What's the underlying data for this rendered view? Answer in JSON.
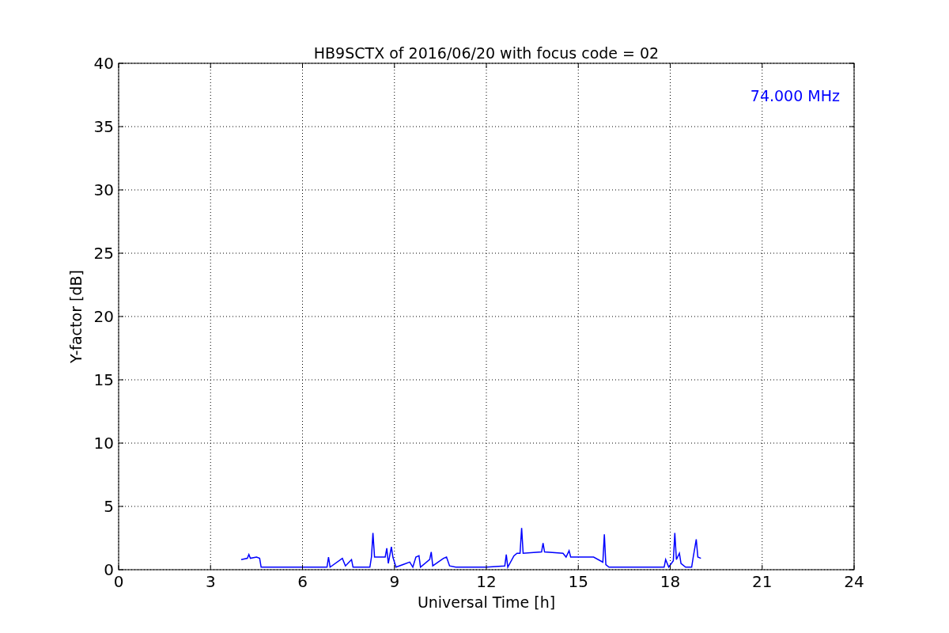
{
  "chart_data": {
    "type": "line",
    "title": "HB9SCTX of 2016/06/20 with focus code = 02",
    "xlabel": "Universal Time [h]",
    "ylabel": "Y-factor [dB]",
    "xlim": [
      0,
      24
    ],
    "ylim": [
      0,
      40
    ],
    "xticks": [
      0,
      3,
      6,
      9,
      12,
      15,
      18,
      21,
      24
    ],
    "yticks": [
      0,
      5,
      10,
      15,
      20,
      25,
      30,
      35,
      40
    ],
    "x": [
      4.0,
      4.2,
      4.25,
      4.3,
      4.5,
      4.6,
      4.65,
      5.0,
      6.0,
      6.8,
      6.85,
      6.9,
      7.3,
      7.4,
      7.6,
      7.65,
      8.2,
      8.25,
      8.3,
      8.35,
      8.7,
      8.75,
      8.8,
      8.9,
      8.95,
      9.05,
      9.5,
      9.6,
      9.7,
      9.8,
      9.85,
      10.15,
      10.2,
      10.25,
      10.6,
      10.7,
      10.8,
      11.0,
      12.0,
      12.6,
      12.65,
      12.7,
      12.9,
      13.0,
      13.1,
      13.15,
      13.2,
      13.8,
      13.85,
      13.9,
      14.5,
      14.6,
      14.7,
      14.75,
      15.5,
      15.8,
      15.85,
      15.9,
      16.0,
      17.0,
      17.8,
      17.85,
      17.95,
      18.1,
      18.15,
      18.2,
      18.3,
      18.35,
      18.5,
      18.7,
      18.75,
      18.85,
      18.9,
      19.0
    ],
    "series": [
      {
        "name": "74.000 MHz",
        "color": "#0000ff",
        "values": [
          0.8,
          0.9,
          1.2,
          0.9,
          1.0,
          0.9,
          0.2,
          0.2,
          0.2,
          0.2,
          1.0,
          0.2,
          0.9,
          0.3,
          0.8,
          0.2,
          0.2,
          1.0,
          2.9,
          1.0,
          1.0,
          1.7,
          0.5,
          1.8,
          1.0,
          0.2,
          0.6,
          0.2,
          1.0,
          1.1,
          0.2,
          0.8,
          1.4,
          0.3,
          0.9,
          1.0,
          0.3,
          0.2,
          0.2,
          0.3,
          1.2,
          0.2,
          1.1,
          1.3,
          1.3,
          3.3,
          1.3,
          1.4,
          2.1,
          1.4,
          1.3,
          1.0,
          1.5,
          1.0,
          1.0,
          0.6,
          2.8,
          0.4,
          0.2,
          0.2,
          0.2,
          0.8,
          0.2,
          0.7,
          2.9,
          0.8,
          1.3,
          0.5,
          0.2,
          0.2,
          1.0,
          2.4,
          1.0,
          0.9
        ]
      }
    ],
    "grid": true
  }
}
